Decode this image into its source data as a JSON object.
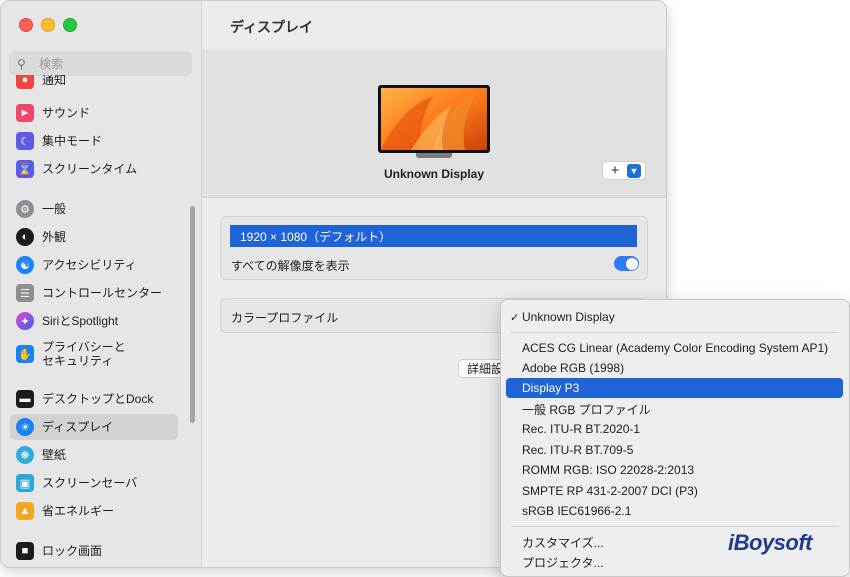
{
  "window": {
    "title": "ディスプレイ"
  },
  "search": {
    "placeholder": "検索"
  },
  "sidebar": {
    "items": [
      {
        "label": "通知",
        "icon": "bell-icon",
        "color": "#f2453d"
      },
      {
        "label": "サウンド",
        "icon": "speaker-icon",
        "color": "#f0476b"
      },
      {
        "label": "集中モード",
        "icon": "moon-icon",
        "color": "#5e5ce6"
      },
      {
        "label": "スクリーンタイム",
        "icon": "hourglass-icon",
        "color": "#5e5ce6"
      },
      {
        "label": "一般",
        "icon": "gear-icon",
        "color": "#8e8e93"
      },
      {
        "label": "外観",
        "icon": "appearance-icon",
        "color": "#1c1c1e"
      },
      {
        "label": "アクセシビリティ",
        "icon": "accessibility-icon",
        "color": "#1a82f7"
      },
      {
        "label": "コントロールセンター",
        "icon": "control-center-icon",
        "color": "#8e8e93"
      },
      {
        "label": "SiriとSpotlight",
        "icon": "siri-icon",
        "color": "#9b3cc9"
      },
      {
        "label": "プライバシーと\nセキュリティ",
        "icon": "hand-icon",
        "color": "#1a82f7"
      },
      {
        "label": "デスクトップとDock",
        "icon": "dock-icon",
        "color": "#1c1c1e"
      },
      {
        "label": "ディスプレイ",
        "icon": "brightness-icon",
        "color": "#1a82f7",
        "selected": true
      },
      {
        "label": "壁紙",
        "icon": "wallpaper-icon",
        "color": "#35aadc"
      },
      {
        "label": "スクリーンセーバ",
        "icon": "screensaver-icon",
        "color": "#2fa6d8"
      },
      {
        "label": "省エネルギー",
        "icon": "battery-icon",
        "color": "#f5a623"
      },
      {
        "label": "ロック画面",
        "icon": "lock-icon",
        "color": "#1c1c1e"
      }
    ]
  },
  "main": {
    "display_name": "Unknown Display",
    "add_button": "+",
    "resolution": {
      "selected": "1920 × 1080（デフォルト）",
      "show_all_label": "すべての解像度を表示",
      "show_all_on": true
    },
    "color_profile_label": "カラープロファイル",
    "details_button": "詳細設定..."
  },
  "dropdown": {
    "current": "Unknown Display",
    "options": [
      "ACES CG Linear (Academy Color Encoding System AP1)",
      "Adobe RGB (1998)",
      "Display P3",
      "一般 RGB プロファイル",
      "Rec. ITU-R BT.2020-1",
      "Rec. ITU-R BT.709-5",
      "ROMM RGB: ISO 22028-2:2013",
      "SMPTE RP 431-2-2007 DCI (P3)",
      "sRGB IEC61966-2.1"
    ],
    "highlighted": "Display P3",
    "extra": [
      "カスタマイズ...",
      "プロジェクタ..."
    ]
  },
  "watermark": "iBoysoft",
  "colors": {
    "accent": "#1f64d6",
    "toggle": "#2f7cf6"
  }
}
